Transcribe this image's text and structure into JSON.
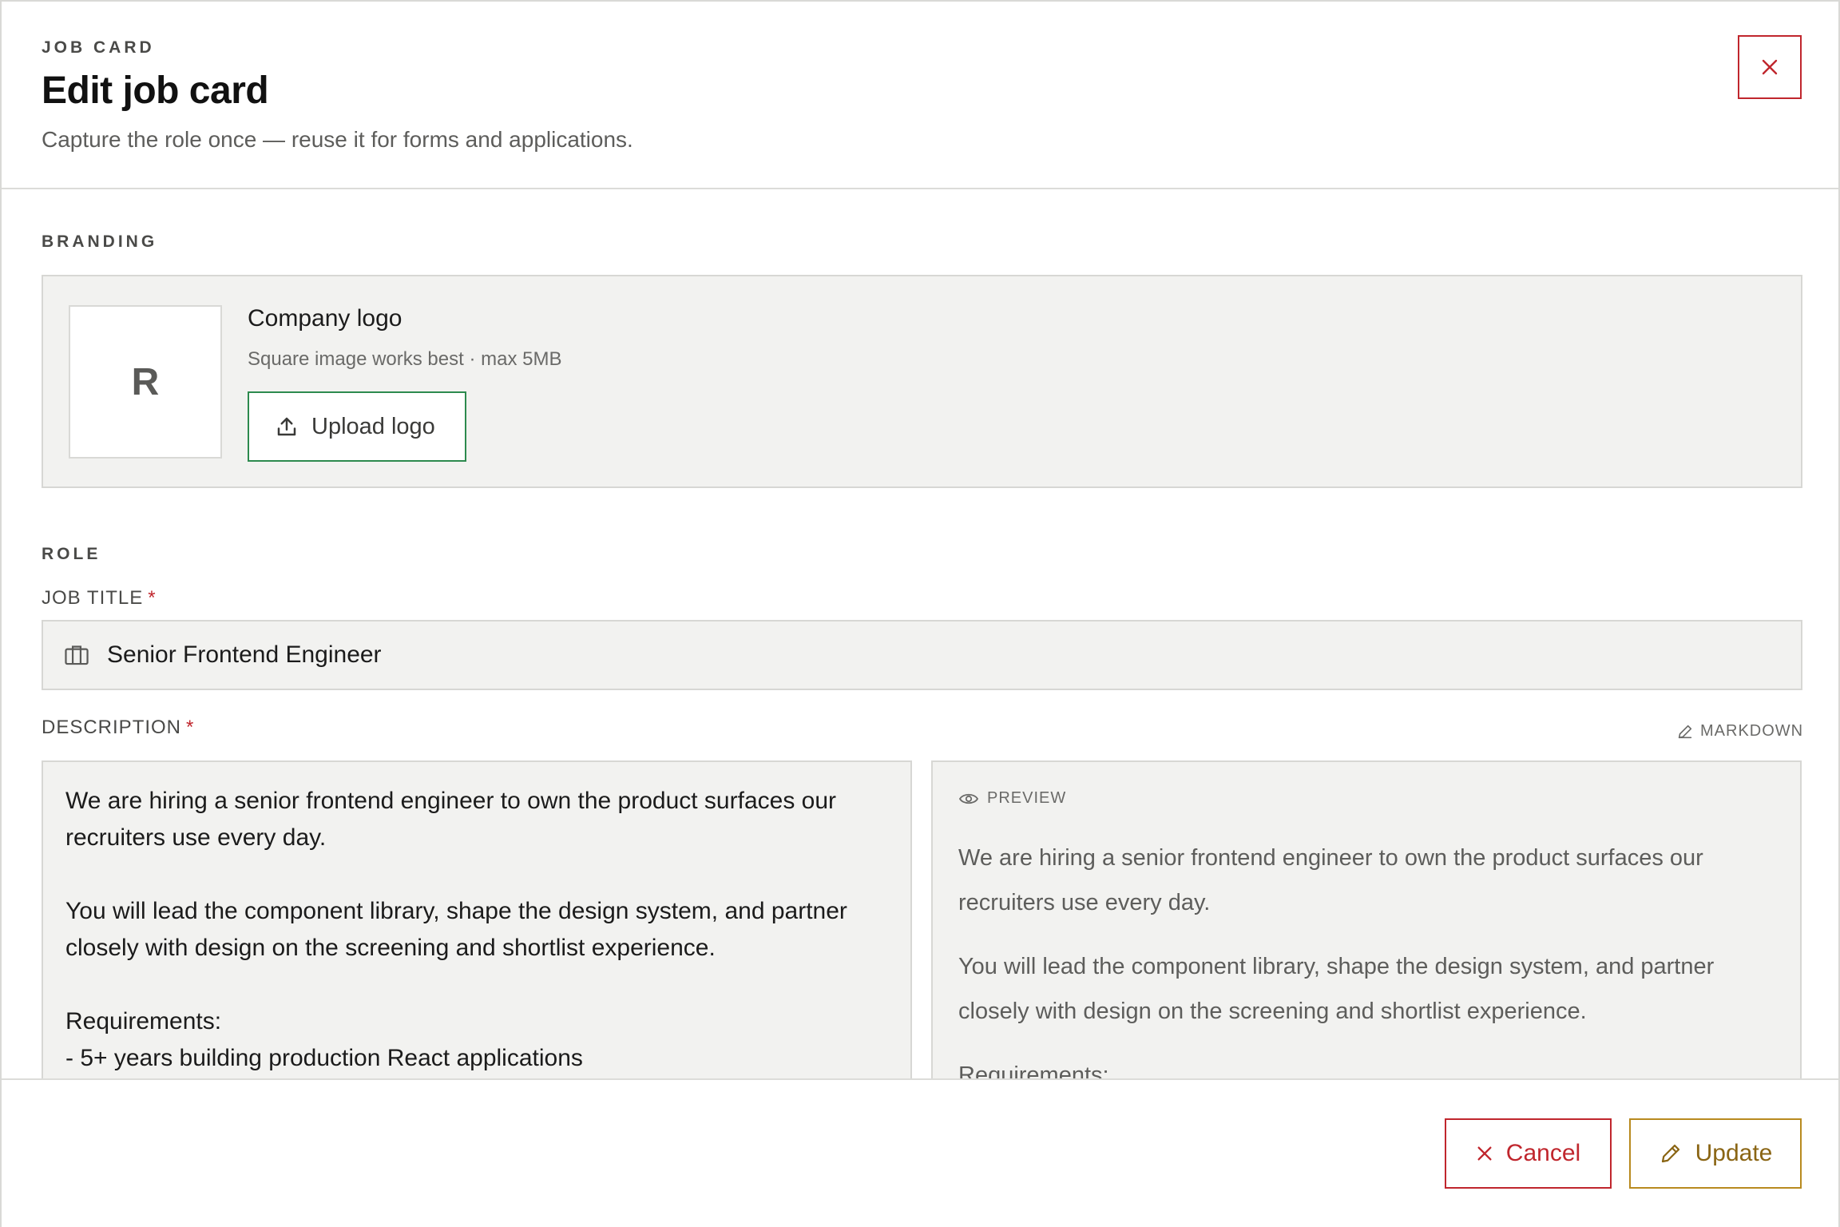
{
  "header": {
    "eyebrow": "JOB CARD",
    "title": "Edit job card",
    "subtitle": "Capture the role once — reuse it for forms and applications."
  },
  "branding": {
    "section_label": "BRANDING",
    "logo_initial": "R",
    "logo_title": "Company logo",
    "logo_hint": "Square image works best · max 5MB",
    "upload_label": "Upload logo"
  },
  "role": {
    "section_label": "ROLE",
    "job_title_label": "JOB TITLE",
    "job_title_value": "Senior Frontend Engineer",
    "required_mark": "*",
    "description_label": "DESCRIPTION",
    "markdown_label": "MARKDOWN",
    "description_text": "We are hiring a senior frontend engineer to own the product surfaces our\nrecruiters use every day.\n\nYou will lead the component library, shape the design system, and partner\nclosely with design on the screening and shortlist experience.\n\nRequirements:\n- 5+ years building production React applications",
    "preview_label": "PREVIEW",
    "preview_paragraphs": [
      "We are hiring a senior frontend engineer to own the product surfaces our recruiters use every day.",
      "You will lead the component library, shape the design system, and partner closely with design on the screening and shortlist experience.",
      "Requirements:"
    ]
  },
  "footer": {
    "cancel_label": "Cancel",
    "update_label": "Update"
  },
  "colors": {
    "danger": "#c0262d",
    "success": "#2d8a4e",
    "warning": "#b88a1f",
    "panel": "#f2f2f0"
  },
  "icons": {
    "close": "close-icon",
    "upload": "upload-icon",
    "briefcase": "briefcase-icon",
    "pencil": "pencil-icon",
    "eye": "eye-icon"
  }
}
